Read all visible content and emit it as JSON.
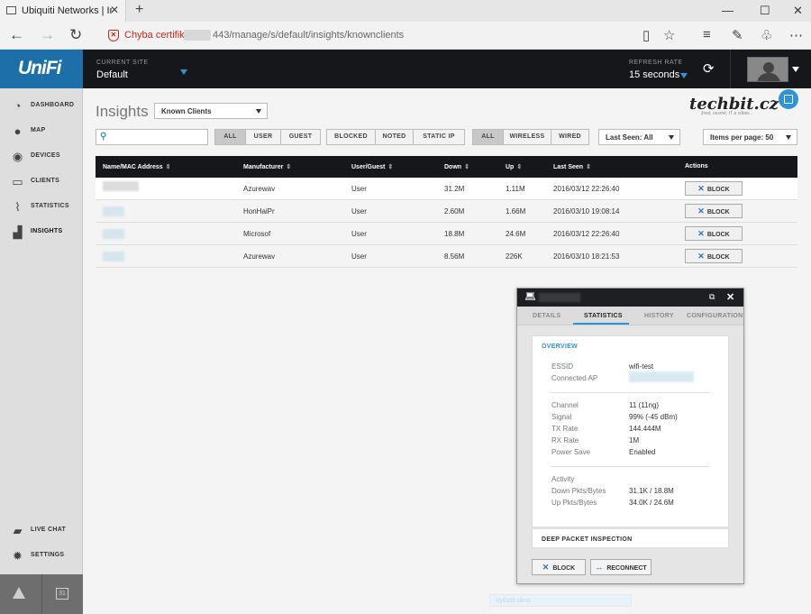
{
  "browser": {
    "tab_title": "Ubiquiti Networks | Insig",
    "tab_close": "✕",
    "new_tab": "+",
    "cert_warning": "Chyba certifikátu",
    "url": "443/manage/s/default/insights/knownclients",
    "window_buttons": [
      "—",
      "☐",
      "✕"
    ]
  },
  "header": {
    "logo": "UniFi",
    "current_site_label": "CURRENT SITE",
    "current_site_value": "Default",
    "refresh_rate_label": "REFRESH RATE",
    "refresh_rate_value": "15 seconds",
    "accent_color": "#2f94d5"
  },
  "sidebar": {
    "items": [
      {
        "label": "DASHBOARD",
        "icon": "dashboard-icon"
      },
      {
        "label": "MAP",
        "icon": "map-pin-icon"
      },
      {
        "label": "DEVICES",
        "icon": "devices-icon"
      },
      {
        "label": "CLIENTS",
        "icon": "laptop-icon"
      },
      {
        "label": "STATISTICS",
        "icon": "line-chart-icon"
      },
      {
        "label": "INSIGHTS",
        "icon": "bar-chart-icon"
      }
    ],
    "bottom_items": [
      {
        "label": "LIVE CHAT",
        "icon": "chat-icon"
      },
      {
        "label": "SETTINGS",
        "icon": "gear-icon"
      }
    ],
    "calendar_day": "31"
  },
  "main": {
    "title": "Insights",
    "view_select": "Known Clients",
    "brand": "techbit.cz",
    "brand_tagline": "život, vesmír, IT a vůbec...",
    "filters": {
      "type": [
        "ALL",
        "USER",
        "GUEST"
      ],
      "status": [
        "BLOCKED",
        "NOTED",
        "STATIC IP"
      ],
      "connection": [
        "ALL",
        "WIRELESS",
        "WIRED"
      ],
      "last_seen": "Last Seen: All",
      "per_page": "Items per page: 50"
    },
    "table": {
      "columns": [
        "Name/MAC Address",
        "Manufacturer",
        "User/Guest",
        "Down",
        "Up",
        "Last Seen",
        "Actions"
      ],
      "rows": [
        {
          "manufacturer": "Azurewav",
          "user_guest": "User",
          "down": "31.2M",
          "up": "1.11M",
          "last_seen": "2016/03/12 22:26:40",
          "action": "BLOCK"
        },
        {
          "manufacturer": "HonHaiPr",
          "user_guest": "User",
          "down": "2.60M",
          "up": "1.66M",
          "last_seen": "2016/03/10 19:08:14",
          "action": "BLOCK"
        },
        {
          "manufacturer": "Microsof",
          "user_guest": "User",
          "down": "18.8M",
          "up": "24.6M",
          "last_seen": "2016/03/12 22:26:40",
          "action": "BLOCK"
        },
        {
          "manufacturer": "Azurewav",
          "user_guest": "User",
          "down": "8.56M",
          "up": "226K",
          "last_seen": "2016/03/10 18:21:53",
          "action": "BLOCK"
        }
      ]
    }
  },
  "panel": {
    "tabs": [
      "DETAILS",
      "STATISTICS",
      "HISTORY",
      "CONFIGURATION"
    ],
    "section_title": "OVERVIEW",
    "essid_label": "ESSID",
    "essid_value": "wifi-test",
    "ap_label": "Connected AP",
    "channel_label": "Channel",
    "channel_value": "11 (11ng)",
    "signal_label": "Signal",
    "signal_value": "99% (-45 dBm)",
    "tx_label": "TX Rate",
    "tx_value": "144.444M",
    "rx_label": "RX Rate",
    "rx_value": "1M",
    "power_label": "Power Save",
    "power_value": "Enabled",
    "activity_label": "Activity",
    "down_pkts_label": "Down Pkts/Bytes",
    "down_pkts_value": "31.1K / 18.8M",
    "up_pkts_label": "Up Pkts/Bytes",
    "up_pkts_value": "34.0K / 24.6M",
    "dpi_label": "DEEP PACKET INSPECTION",
    "block_label": "BLOCK",
    "reconnect_label": "RECONNECT"
  },
  "ghost_label": "Vyčistit okno"
}
